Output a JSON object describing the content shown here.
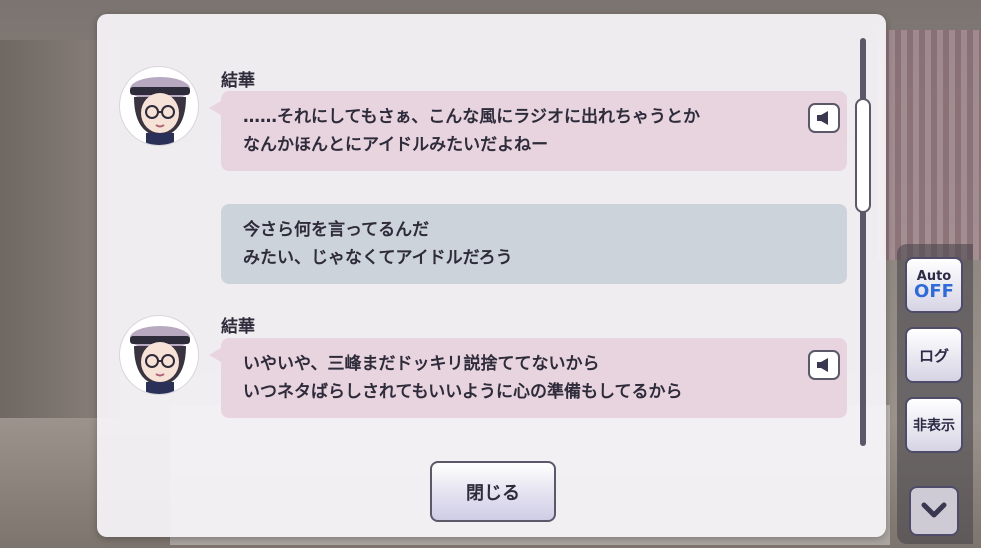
{
  "side_controls": {
    "auto_label": "Auto",
    "auto_value": "OFF",
    "log_label": "ログ",
    "hide_label": "非表示"
  },
  "messages": [
    {
      "speaker": "結華",
      "lines": [
        "……それにしてもさぁ、こんな風にラジオに出れちゃうとか",
        "なんかほんとにアイドルみたいだよねー"
      ],
      "has_voice": true
    },
    {
      "speaker": "",
      "lines": [
        "今さら何を言ってるんだ",
        "みたい、じゃなくてアイドルだろう"
      ],
      "has_voice": false
    },
    {
      "speaker": "結華",
      "lines": [
        "いやいや、三峰まだドッキリ説捨ててないから",
        "いつネタばらしされてもいいように心の準備もしてるから"
      ],
      "has_voice": true
    }
  ],
  "close_label": "閉じる",
  "colors": {
    "pink_bubble": "#e8d4de",
    "gray_bubble": "#cdd3da",
    "accent_blue": "#2f6bd6"
  },
  "icons": [
    "speaker-icon",
    "chevron-down-icon",
    "avatar-yuika"
  ]
}
